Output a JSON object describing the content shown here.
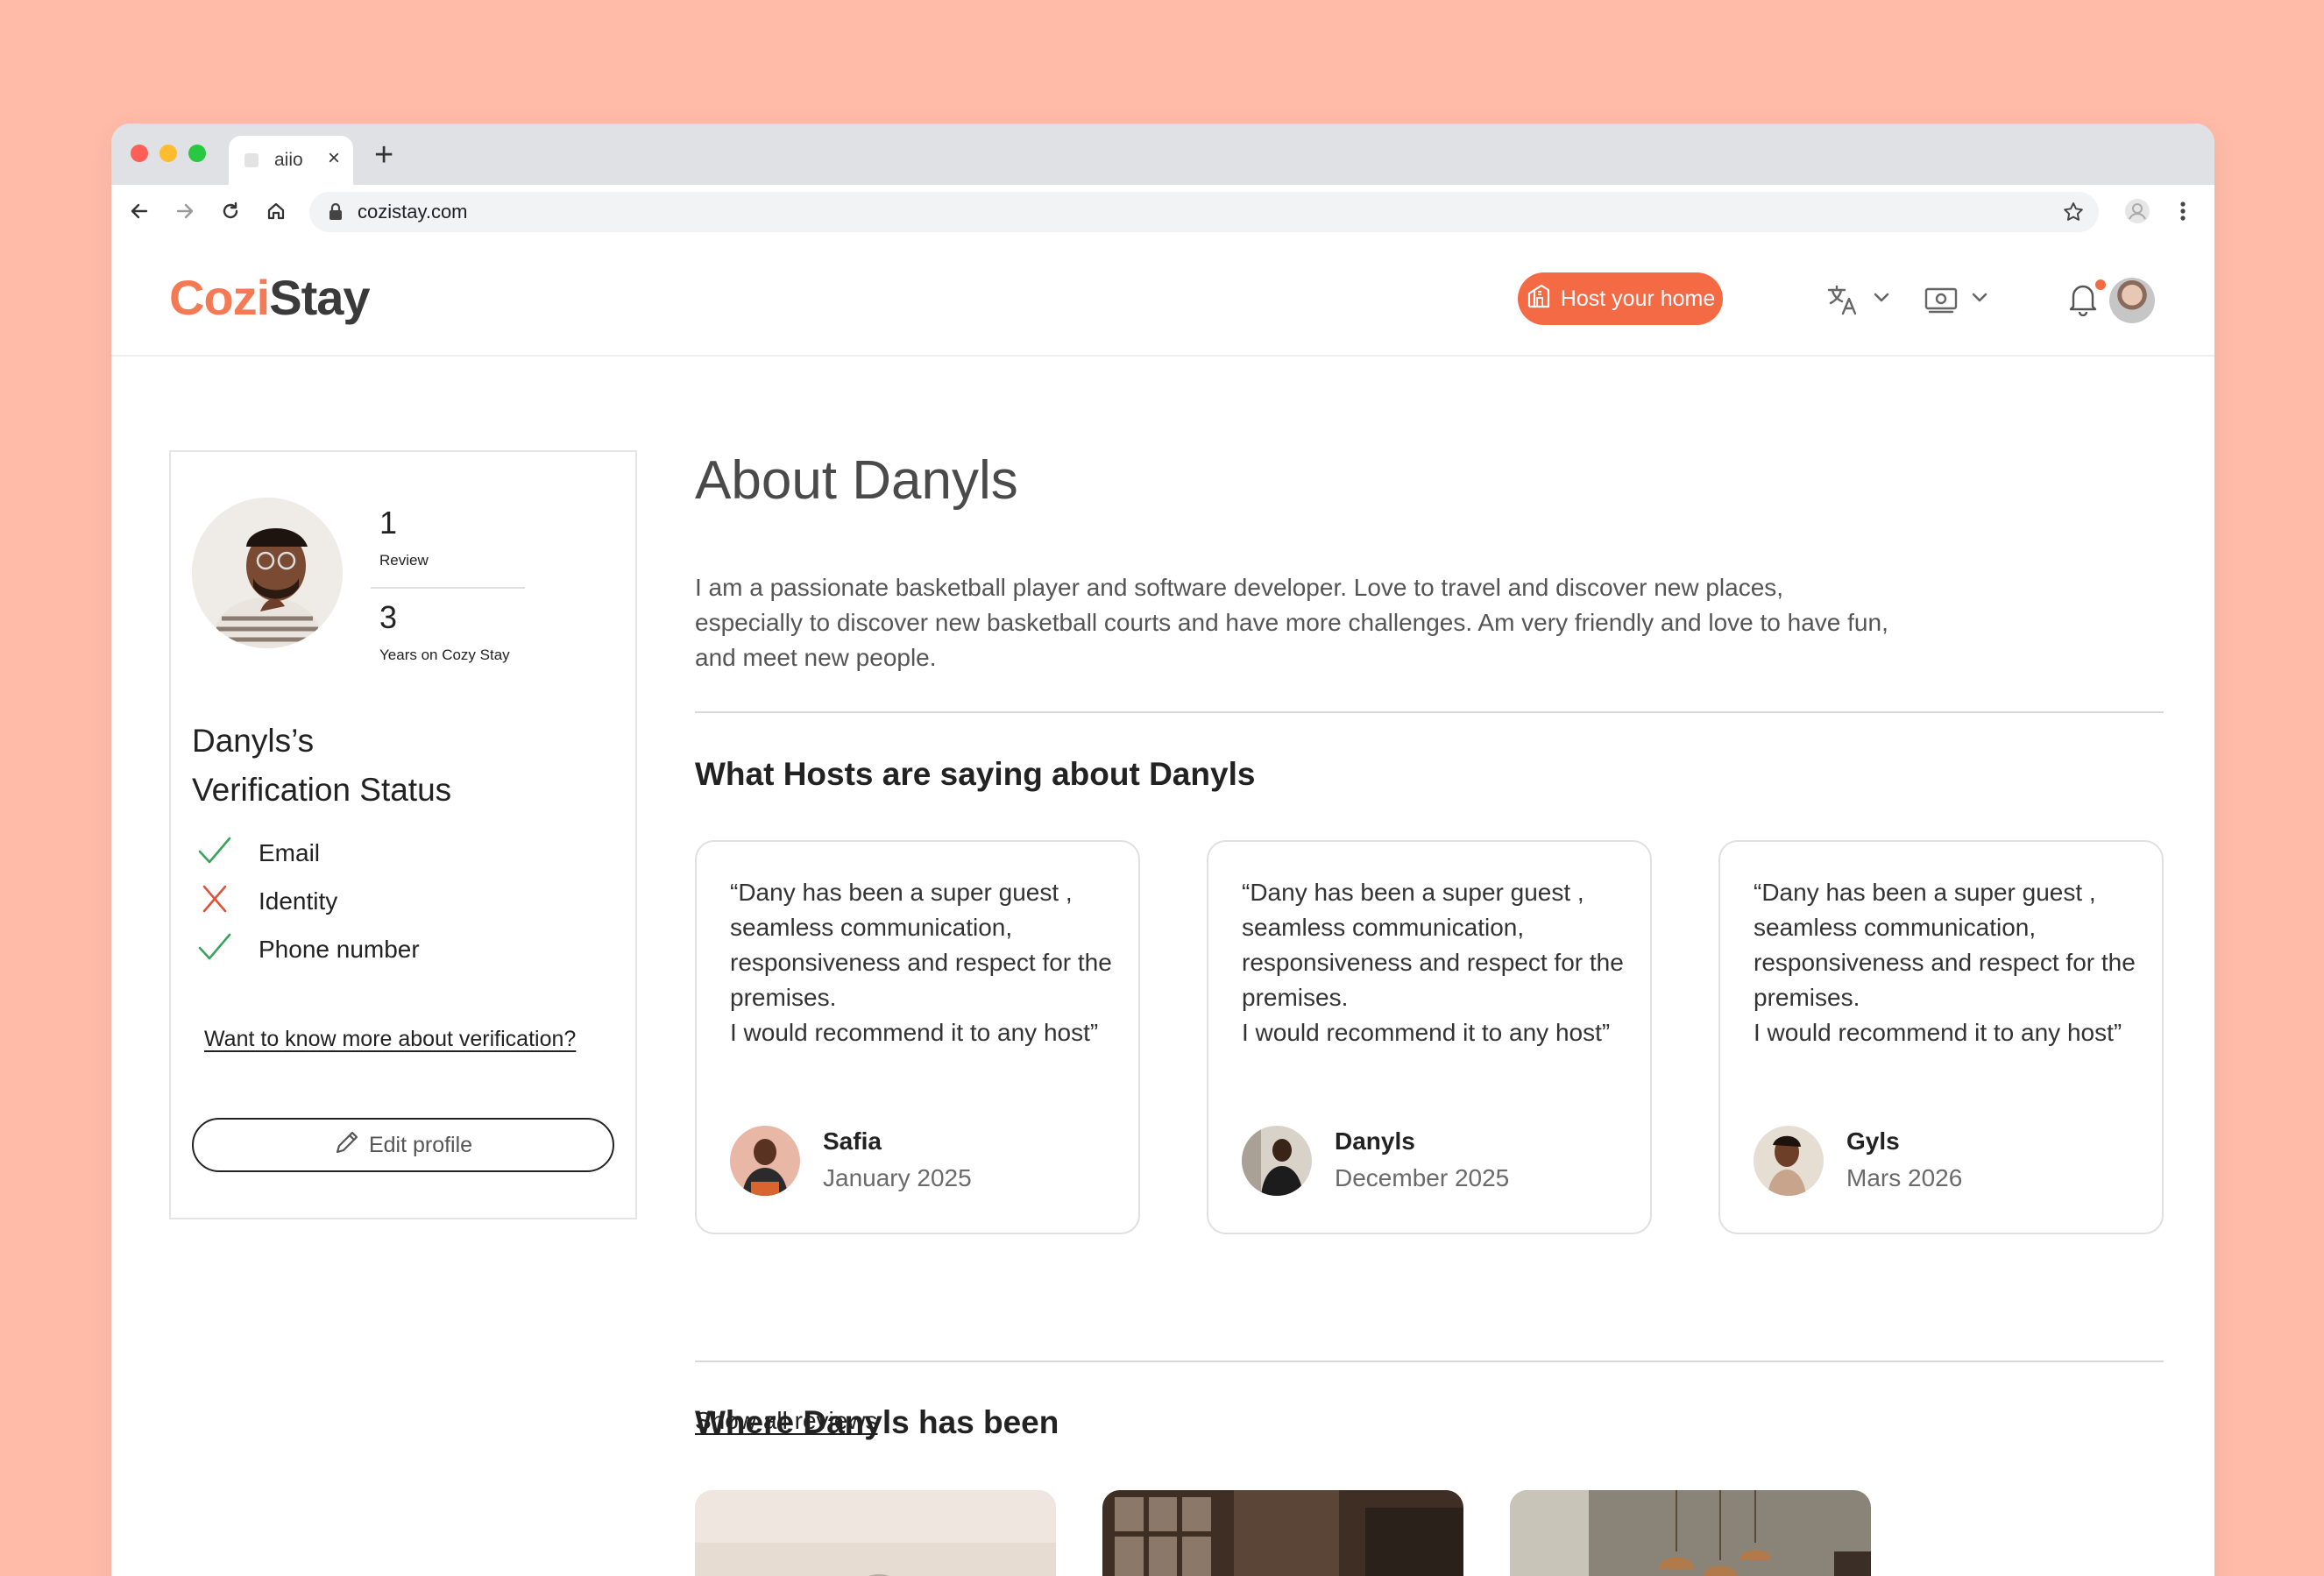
{
  "browser": {
    "tab_title": "aiio",
    "url": "cozistay.com"
  },
  "header": {
    "logo": {
      "part1": "Cozi",
      "part2": "Stay"
    },
    "host_button": "Host your home",
    "icons": [
      "language-icon",
      "currency-icon",
      "bell-icon"
    ]
  },
  "profile": {
    "stats": [
      {
        "value": "1",
        "label": "Review"
      },
      {
        "value": "3",
        "label": "Years on Cozy Stay"
      }
    ],
    "verification_title_line1": "Danyls’s",
    "verification_title_line2": "Verification Status",
    "verification": [
      {
        "label": "Email",
        "status": "verified"
      },
      {
        "label": "Identity",
        "status": "not-verified"
      },
      {
        "label": "Phone number",
        "status": "verified"
      }
    ],
    "verification_link": "Want to know more about verification?",
    "edit_button": "Edit profile"
  },
  "main": {
    "title": "About Danyls",
    "bio": "I am a passionate basketball player and software developer. Love to travel and discover new places, especially to discover new basketball courts and have more challenges. Am very friendly and love to have fun, and meet new people.",
    "reviews_title": "What Hosts are saying about Danyls",
    "reviews": [
      {
        "text": "“Dany has been a super guest , seamless communication, responsiveness and respect for the premises.\nI would recommend it to any host”",
        "name": "Safia",
        "date": "January 2025"
      },
      {
        "text": "“Dany has been a super guest , seamless communication, responsiveness and respect for the premises.\nI would recommend it to any host”",
        "name": "Danyls",
        "date": "December 2025"
      },
      {
        "text": "“Dany has been a super guest , seamless communication, responsiveness and respect for the premises.\nI would recommend it to any host”",
        "name": "Gyls",
        "date": "Mars 2026"
      }
    ],
    "show_all": "Show all reviews",
    "places_title": "Where Danyls has been"
  },
  "colors": {
    "background": "#FFBBA8",
    "accent": "#F46A45",
    "verified": "#3aa35a",
    "not_verified": "#e0533a"
  }
}
